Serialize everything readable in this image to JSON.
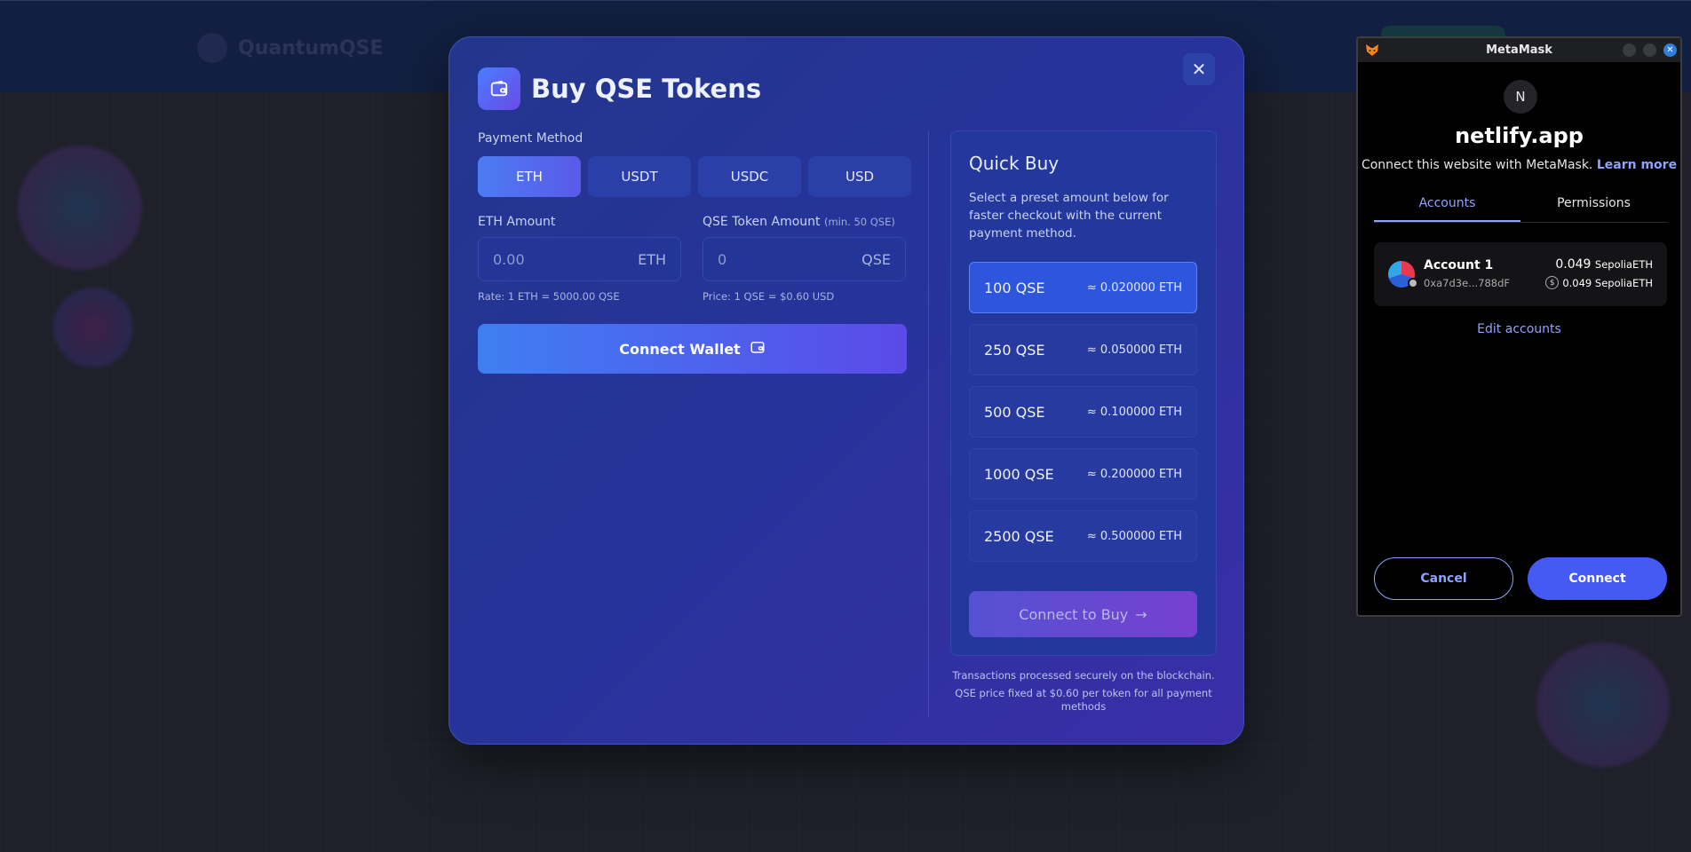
{
  "background": {
    "logo_text": "QuantumQSE"
  },
  "modal": {
    "title": "Buy QSE Tokens",
    "close_icon": "close-icon",
    "payment_method_label": "Payment Method",
    "payment_methods": [
      {
        "label": "ETH",
        "active": true
      },
      {
        "label": "USDT",
        "active": false
      },
      {
        "label": "USDC",
        "active": false
      },
      {
        "label": "USD",
        "active": false
      }
    ],
    "eth_amount": {
      "label": "ETH Amount",
      "placeholder": "0.00",
      "unit": "ETH",
      "hint": "Rate: 1 ETH = 5000.00 QSE"
    },
    "qse_amount": {
      "label": "QSE Token Amount",
      "min_note": "(min. 50 QSE)",
      "placeholder": "0",
      "unit": "QSE",
      "hint": "Price: 1 QSE = $0.60 USD"
    },
    "connect_wallet_label": "Connect Wallet",
    "quick_buy": {
      "title": "Quick Buy",
      "description": "Select a preset amount below for faster checkout with the current payment method.",
      "items": [
        {
          "qse": "100 QSE",
          "eth": "≈ 0.020000 ETH",
          "active": true
        },
        {
          "qse": "250 QSE",
          "eth": "≈ 0.050000 ETH",
          "active": false
        },
        {
          "qse": "500 QSE",
          "eth": "≈ 0.100000 ETH",
          "active": false
        },
        {
          "qse": "1000 QSE",
          "eth": "≈ 0.200000 ETH",
          "active": false
        },
        {
          "qse": "2500 QSE",
          "eth": "≈ 0.500000 ETH",
          "active": false
        }
      ],
      "connect_to_buy_label": "Connect to Buy"
    },
    "footnote_1": "Transactions processed securely on the blockchain.",
    "footnote_2": "QSE price fixed at $0.60 per token for all payment methods"
  },
  "metamask": {
    "window_title": "MetaMask",
    "avatar_letter": "N",
    "site": "netlify.app",
    "subtitle": "Connect this website with MetaMask.",
    "learn_more": "Learn more",
    "tabs": [
      {
        "label": "Accounts",
        "active": true
      },
      {
        "label": "Permissions",
        "active": false
      }
    ],
    "account": {
      "name": "Account 1",
      "address": "0xa7d3e...788dF",
      "balance": "0.049",
      "balance_unit": "SepoliaETH",
      "balance2": "0.049 SepoliaETH"
    },
    "edit_accounts": "Edit accounts",
    "cancel_label": "Cancel",
    "connect_label": "Connect"
  }
}
